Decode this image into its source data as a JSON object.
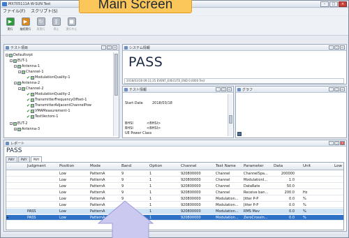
{
  "window": {
    "title": "MX705111A W-SUN Test",
    "min": "–",
    "max": "□",
    "close": "×"
  },
  "callout": {
    "text": "Main Screen"
  },
  "menu": [
    "ファイル(F)",
    "スクリプト(S)"
  ],
  "toolbar": {
    "run": "実行",
    "continue": "継続実行",
    "resume": "再実行",
    "stop": "停止",
    "cancel": "実行中止"
  },
  "test_panel": {
    "title": "テスト項目",
    "tree": [
      "Defaultsrpt",
      "EUT-1",
      "Antenna-1",
      "Channel-1",
      "ModulationQuality-1",
      "Antenna-2",
      "Channel-2",
      "ModulationQuality-2",
      "TransmitterFrequencyOffset-1",
      "TransmitterAdjacentChannelPow",
      "VMAMeasurement-1",
      "TestVectors-1",
      "EUT-2",
      "Antenna-3"
    ]
  },
  "system_panel": {
    "title": "システム情報",
    "result": "PASS",
    "status_line": "2018/03/18 09:11:25 EVENT_EXECUTE_END 0.0000 Test"
  },
  "test_info_panel": {
    "title": "テスト情報",
    "start_label": "Start Date",
    "start_value": "2018/03/18",
    "line2_label": "BHSI",
    "line2_value": "<BHSI>",
    "line3_label": "BHSI",
    "line3_value": "<BHSI>",
    "line4_label": "UE Power Class"
  },
  "graph_panel": {
    "title": "グラフ"
  },
  "report_panel": {
    "title": "レポート",
    "result": "PASS",
    "tabs": [
      "PWY",
      "PWY",
      "PWY"
    ],
    "columns": [
      "Judgment",
      "Position",
      "Mode",
      "Band",
      "Option",
      "Channel",
      "Test Name",
      "Parameter",
      "Data",
      "Unit",
      "Low"
    ],
    "rows": [
      [
        "",
        "Low",
        "PatternA",
        "9",
        "1",
        "920800000",
        "Channel",
        "ChannelSpa...",
        "200000",
        "",
        ""
      ],
      [
        "",
        "Low",
        "PatternA",
        "9",
        "1",
        "920800000",
        "Channel",
        "ModulationI...",
        "1.0",
        "",
        ""
      ],
      [
        "",
        "Low",
        "PatternA",
        "9",
        "1",
        "920800000",
        "Channel",
        "DataRate",
        "50.0",
        "",
        ""
      ],
      [
        "",
        "Low",
        "PatternA",
        "9",
        "1",
        "920800000",
        "Channel",
        "Receive ban...",
        "200.0",
        "Hz",
        ""
      ],
      [
        "",
        "Low",
        "PatternA",
        "9",
        "1",
        "920800000",
        "Modulation...",
        "Jitter P-P",
        "0.0",
        "%",
        ""
      ],
      [
        "",
        "Low",
        "PatternA",
        "9",
        "1",
        "920800000",
        "Modulation...",
        "Jitter P-P",
        "0.0",
        "%",
        ""
      ],
      [
        "PASS",
        "Low",
        "PatternA",
        "9",
        "1",
        "920800000",
        "Modulation...",
        "RMS Mev",
        "0.0",
        "%",
        ""
      ],
      [
        "PASS",
        "Low",
        "PatternA",
        "9",
        "1",
        "920800000",
        "Modulation...",
        "ZeroCrossin...",
        "0.0",
        "%",
        ""
      ]
    ]
  },
  "colors": {
    "accent": "#2d72c7",
    "callout": "#fbc75a",
    "bubble": "#cbc9ef",
    "pass_run": "#2f9b3b"
  }
}
